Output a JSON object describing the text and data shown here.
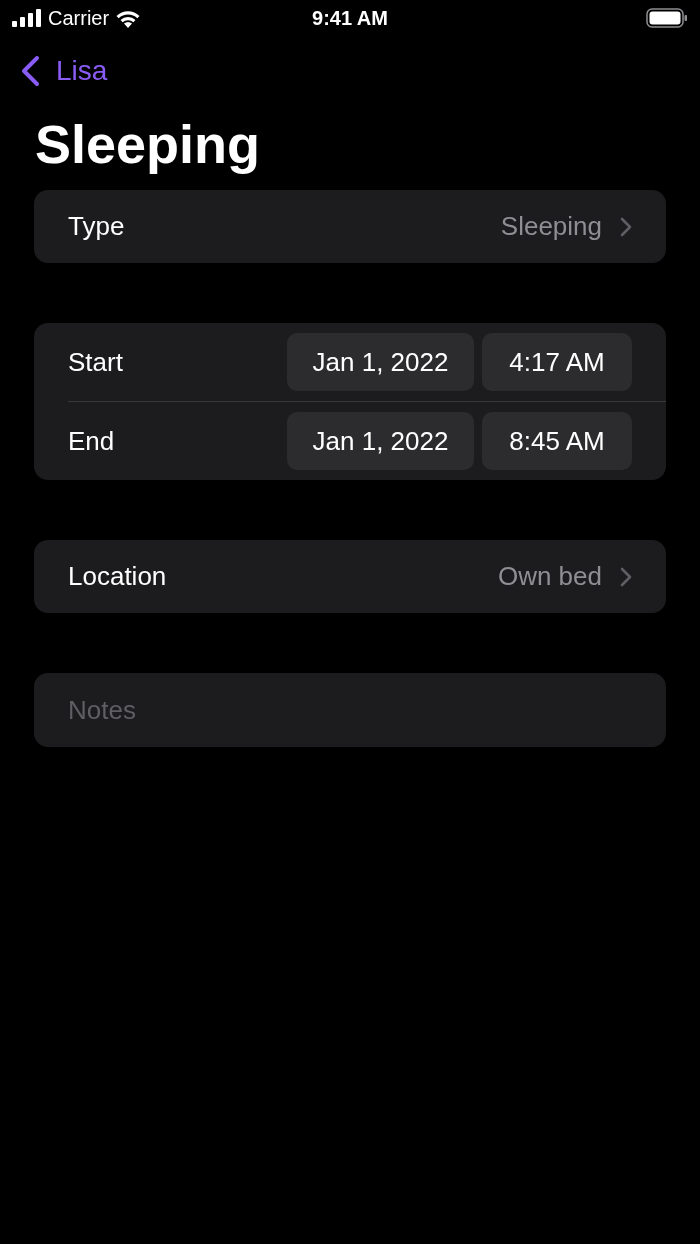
{
  "status_bar": {
    "carrier": "Carrier",
    "time": "9:41 AM"
  },
  "nav": {
    "back_label": "Lisa"
  },
  "title": "Sleeping",
  "sections": [
    {
      "kind": "link",
      "label": "Type",
      "value": "Sleeping"
    },
    {
      "kind": "datetime",
      "rows": [
        {
          "label": "Start",
          "date": "Jan 1, 2022",
          "time": "4:17 AM"
        },
        {
          "label": "End",
          "date": "Jan 1, 2022",
          "time": "8:45 AM"
        }
      ]
    },
    {
      "kind": "link",
      "label": "Location",
      "value": "Own bed"
    },
    {
      "kind": "notes",
      "placeholder": "Notes"
    }
  ]
}
